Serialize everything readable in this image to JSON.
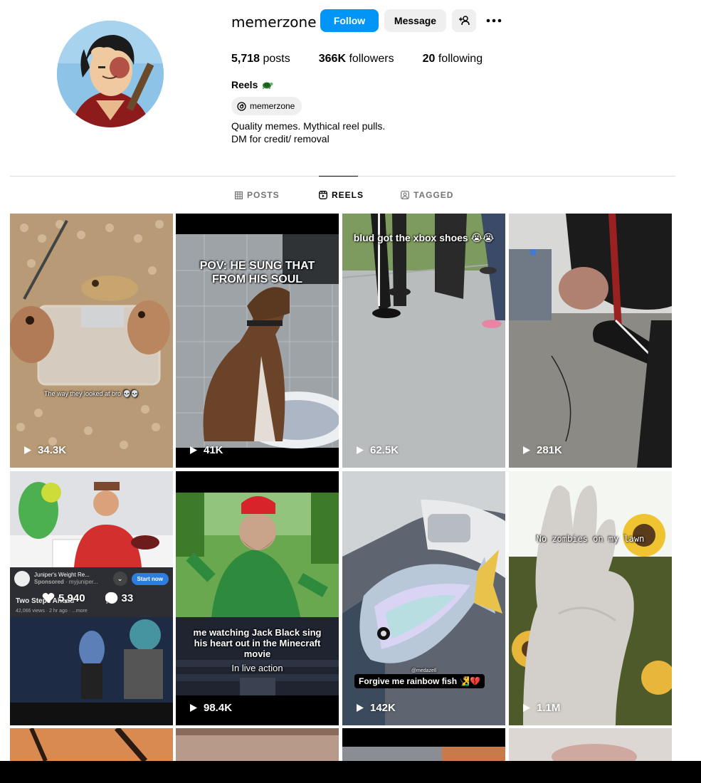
{
  "profile": {
    "username": "memerzone",
    "follow_label": "Follow",
    "message_label": "Message",
    "stats": {
      "posts_count": "5,718",
      "posts_label": "posts",
      "followers_count": "366K",
      "followers_label": "followers",
      "following_count": "20",
      "following_label": "following"
    },
    "bio_name": "Reels",
    "threads_handle": "memerzone",
    "bio_line1": "Quality memes. Mythical reel pulls.",
    "bio_line2": "DM for credit/ removal"
  },
  "tabs": [
    {
      "label": "POSTS",
      "icon": "grid-icon",
      "active": false
    },
    {
      "label": "REELS",
      "icon": "reels-icon",
      "active": true
    },
    {
      "label": "TAGGED",
      "icon": "tagged-icon",
      "active": false
    }
  ],
  "reels": [
    {
      "views": "34.3K",
      "caption": "The way they looked at bro 💀💀"
    },
    {
      "views": "41K",
      "caption": "POV: HE SUNG THAT FROM HIS SOUL"
    },
    {
      "views": "62.5K",
      "caption": "blud got the xbox shoes 😭😭"
    },
    {
      "views": "281K",
      "caption": ""
    },
    {
      "likes": "5,940",
      "comments": "33",
      "ad_title": "Juniper's Weight Re...",
      "ad_sponsored": "Sponsored",
      "ad_source": "· myjuniper...",
      "ad_cta": "Start now",
      "ad_video_title": "Two Steps Ahead",
      "ad_meta": "42,066 views · 2 hr ago · ...more"
    },
    {
      "views": "98.4K",
      "caption": "me watching Jack Black sing his heart out in the Minecraft movie",
      "caption2": "In live action"
    },
    {
      "views": "142K",
      "caption": "Forgive me rainbow fish 🧏‍♂️💔",
      "watermark": "@medazell"
    },
    {
      "views": "1.1M",
      "caption": "No zombies on my lawn"
    }
  ],
  "colors": {
    "accent": "#0095f6",
    "button_bg": "#efefef",
    "muted_text": "#737373",
    "divider": "#dbdbdb"
  }
}
